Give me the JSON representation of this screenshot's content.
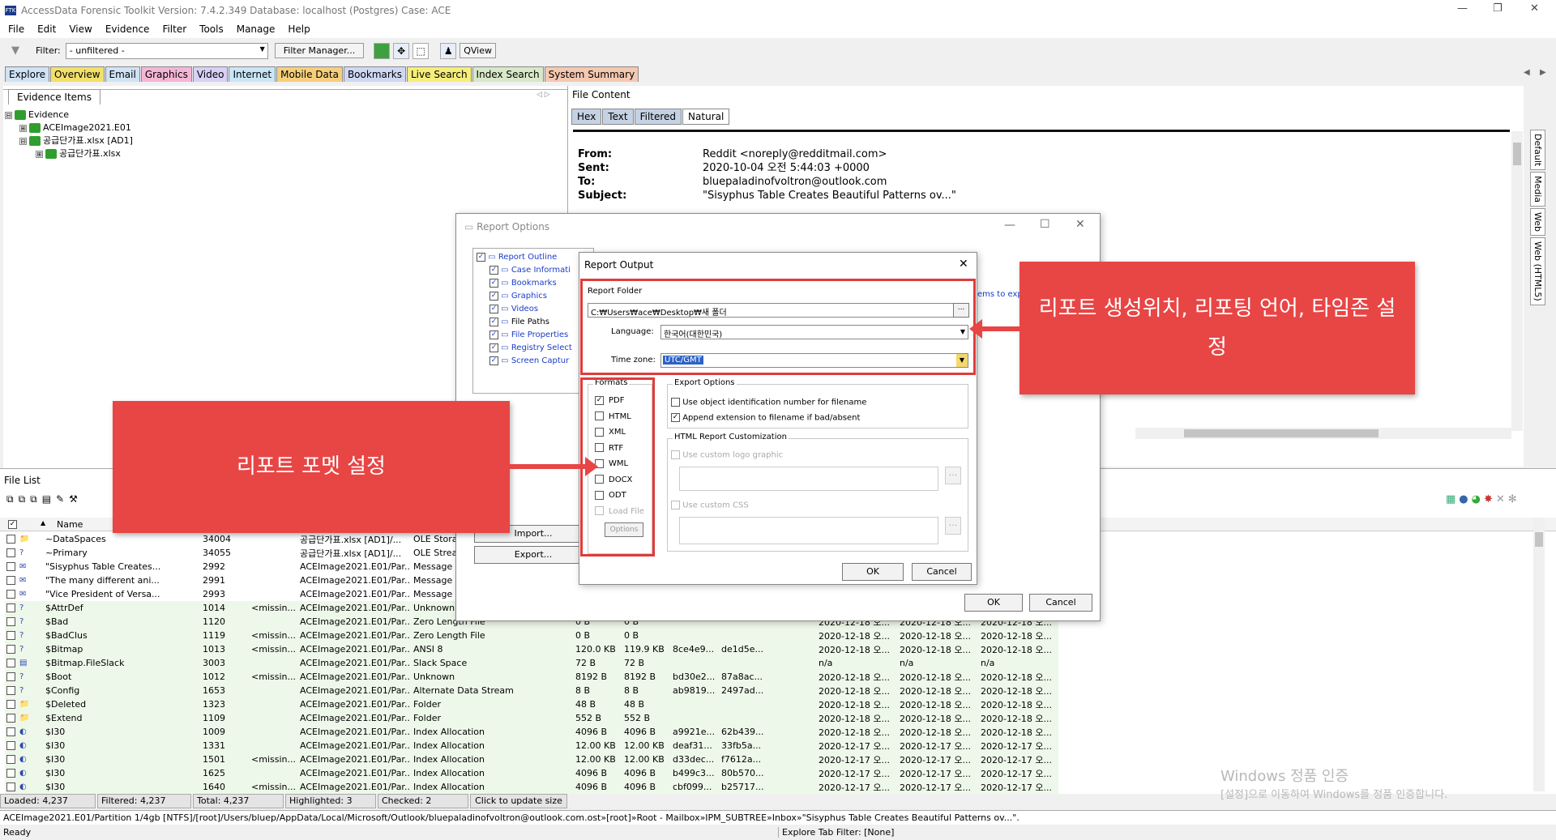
{
  "window": {
    "title": "AccessData Forensic Toolkit Version: 7.4.2.349 Database: localhost (Postgres) Case: ACE",
    "min": "—",
    "max": "❐",
    "close": "✕"
  },
  "menu": [
    "File",
    "Edit",
    "View",
    "Evidence",
    "Filter",
    "Tools",
    "Manage",
    "Help"
  ],
  "toolbar": {
    "filter_label": "Filter:",
    "filter_value": "- unfiltered -",
    "filter_manager": "Filter Manager...",
    "qview": "QView"
  },
  "main_tabs": [
    "Explore",
    "Overview",
    "Email",
    "Graphics",
    "Video",
    "Internet",
    "Mobile Data",
    "Bookmarks",
    "Live Search",
    "Index Search",
    "System Summary"
  ],
  "evidence_pane": {
    "tab": "Evidence Items",
    "tree": [
      {
        "label": "Evidence",
        "toggle": "⊟"
      },
      {
        "label": "ACEImage2021.E01",
        "toggle": "⊞"
      },
      {
        "label": "공급단가표.xlsx [AD1]",
        "toggle": "⊟"
      },
      {
        "label": "공급단가표.xlsx",
        "toggle": "⊞"
      }
    ]
  },
  "file_content": {
    "title": "File Content",
    "tabs": [
      "Hex",
      "Text",
      "Filtered",
      "Natural"
    ],
    "email": {
      "from_label": "From:",
      "from": "Reddit <noreply@redditmail.com>",
      "sent_label": "Sent:",
      "sent": "2020-10-04 오전 5:44:03 +0000",
      "to_label": "To:",
      "to": "bluepaladinofvoltron@outlook.com",
      "subject_label": "Subject:",
      "subject": "\"Sisyphus Table Creates Beautiful Patterns ov...\""
    }
  },
  "side_tabs": [
    "Default",
    "Media",
    "Web",
    "Web (HTML5)"
  ],
  "report_options": {
    "title": "Report Options",
    "outline": [
      "Report Outline",
      "Case Informati",
      "Bookmarks",
      "Graphics",
      "Videos",
      "File Paths",
      "File Properties",
      "Registry Select",
      "Screen Captur"
    ],
    "import": "Import...",
    "export": "Export...",
    "ok": "OK",
    "cancel": "Cancel",
    "items_to_exp": "ems to exp"
  },
  "report_output": {
    "title": "Report Output",
    "folder_label": "Report Folder",
    "folder_value": "C:₩Users₩ace₩Desktop₩새 폴더",
    "browse": "...",
    "language_label": "Language:",
    "language_value": "한국어(대한민국)",
    "tz_label": "Time zone:",
    "tz_value": "UTC/GMT",
    "formats_label": "Formats",
    "formats": [
      {
        "name": "PDF",
        "checked": true
      },
      {
        "name": "HTML",
        "checked": false
      },
      {
        "name": "XML",
        "checked": false
      },
      {
        "name": "RTF",
        "checked": false
      },
      {
        "name": "WML",
        "checked": false
      },
      {
        "name": "DOCX",
        "checked": false
      },
      {
        "name": "ODT",
        "checked": false
      },
      {
        "name": "Load File",
        "checked": false
      }
    ],
    "options_btn": "Options",
    "export_options_label": "Export Options",
    "export_opt1": "Use object identification number for filename",
    "export_opt2": "Append extension to filename if bad/absent",
    "html_custom_label": "HTML Report Customization",
    "logo_label": "Use custom logo graphic",
    "css_label": "Use custom CSS",
    "ok": "OK",
    "cancel": "Cancel"
  },
  "callouts": {
    "top": "리포트 생성위치, 리포팅 언어, 타임존 설정",
    "left": "리포트 포멧 설정"
  },
  "file_list": {
    "title": "File List",
    "name_header": "Name",
    "rows": [
      [
        "~DataSpaces",
        "34004",
        "",
        "공급단가표.xlsx [AD1]/...",
        "OLE Storag",
        "",
        "",
        "",
        "",
        "",
        "",
        ""
      ],
      [
        "~Primary",
        "34055",
        "",
        "공급단가표.xlsx [AD1]/...",
        "OLE Stream",
        "",
        "",
        "",
        "",
        "",
        "",
        ""
      ],
      [
        "\"Sisyphus Table Creates...",
        "2992",
        "",
        "ACEImage2021.E01/Par...",
        "Message",
        "",
        "",
        "",
        "",
        "",
        "",
        ""
      ],
      [
        "\"The many different ani...",
        "2991",
        "",
        "ACEImage2021.E01/Par...",
        "Message",
        "",
        "",
        "",
        "",
        "",
        "",
        ""
      ],
      [
        "\"Vice President of Versa...",
        "2993",
        "",
        "ACEImage2021.E01/Par...",
        "Message",
        "",
        "",
        "",
        "",
        "",
        "",
        ""
      ],
      [
        "$AttrDef",
        "1014",
        "<missin...",
        "ACEImage2021.E01/Par...",
        "Unknown",
        "",
        "",
        "",
        "",
        "",
        "",
        ""
      ],
      [
        "$Bad",
        "1120",
        "",
        "ACEImage2021.E01/Par...",
        "Zero Length File",
        "0 B",
        "0 B",
        "",
        "",
        "2020-12-18 오...",
        "2020-12-18 오...",
        "2020-12-18 오..."
      ],
      [
        "$BadClus",
        "1119",
        "<missin...",
        "ACEImage2021.E01/Par...",
        "Zero Length File",
        "0 B",
        "0 B",
        "",
        "",
        "2020-12-18 오...",
        "2020-12-18 오...",
        "2020-12-18 오..."
      ],
      [
        "$Bitmap",
        "1013",
        "<missin...",
        "ACEImage2021.E01/Par...",
        "ANSI 8",
        "120.0 KB",
        "119.9 KB",
        "8ce4e9...",
        "de1d5e...",
        "2020-12-18 오...",
        "2020-12-18 오...",
        "2020-12-18 오..."
      ],
      [
        "$Bitmap.FileSlack",
        "3003",
        "",
        "ACEImage2021.E01/Par...",
        "Slack Space",
        "72 B",
        "72 B",
        "",
        "",
        "n/a",
        "n/a",
        "n/a"
      ],
      [
        "$Boot",
        "1012",
        "<missin...",
        "ACEImage2021.E01/Par...",
        "Unknown",
        "8192 B",
        "8192 B",
        "bd30e2...",
        "87a8ac...",
        "2020-12-18 오...",
        "2020-12-18 오...",
        "2020-12-18 오..."
      ],
      [
        "$Config",
        "1653",
        "",
        "ACEImage2021.E01/Par...",
        "Alternate Data Stream",
        "8 B",
        "8 B",
        "ab9819...",
        "2497ad...",
        "2020-12-18 오...",
        "2020-12-18 오...",
        "2020-12-18 오..."
      ],
      [
        "$Deleted",
        "1323",
        "",
        "ACEImage2021.E01/Par...",
        "Folder",
        "48 B",
        "48 B",
        "",
        "",
        "2020-12-18 오...",
        "2020-12-18 오...",
        "2020-12-18 오..."
      ],
      [
        "$Extend",
        "1109",
        "",
        "ACEImage2021.E01/Par...",
        "Folder",
        "552 B",
        "552 B",
        "",
        "",
        "2020-12-18 오...",
        "2020-12-18 오...",
        "2020-12-18 오..."
      ],
      [
        "$I30",
        "1009",
        "",
        "ACEImage2021.E01/Par...",
        "Index Allocation",
        "4096 B",
        "4096 B",
        "a9921e...",
        "62b439...",
        "2020-12-18 오...",
        "2020-12-18 오...",
        "2020-12-18 오..."
      ],
      [
        "$I30",
        "1331",
        "",
        "ACEImage2021.E01/Par...",
        "Index Allocation",
        "12.00 KB",
        "12.00 KB",
        "deaf31...",
        "33fb5a...",
        "2020-12-17 오...",
        "2020-12-17 오...",
        "2020-12-17 오..."
      ],
      [
        "$I30",
        "1501",
        "<missin...",
        "ACEImage2021.E01/Par...",
        "Index Allocation",
        "12.00 KB",
        "12.00 KB",
        "d33dec...",
        "f7612a...",
        "2020-12-17 오...",
        "2020-12-17 오...",
        "2020-12-17 오..."
      ],
      [
        "$I30",
        "1625",
        "",
        "ACEImage2021.E01/Par...",
        "Index Allocation",
        "4096 B",
        "4096 B",
        "b499c3...",
        "80b570...",
        "2020-12-17 오...",
        "2020-12-17 오...",
        "2020-12-17 오..."
      ],
      [
        "$I30",
        "1640",
        "<missin...",
        "ACEImage2021.E01/Par...",
        "Index Allocation",
        "4096 B",
        "4096 B",
        "cbf099...",
        "b25717...",
        "2020-12-17 오...",
        "2020-12-17 오...",
        "2020-12-17 오..."
      ]
    ]
  },
  "status": {
    "loaded": "Loaded: 4,237",
    "filtered": "Filtered: 4,237",
    "total": "Total: 4,237",
    "highlighted": "Highlighted: 3",
    "checked": "Checked: 2",
    "update": "Click to update size",
    "path": "ACEImage2021.E01/Partition 1/4gb [NTFS]/[root]/Users/bluep/AppData/Local/Microsoft/Outlook/bluepaladinofvoltron@outlook.com.ost»[root]»Root - Mailbox»IPM_SUBTREE»Inbox»\"Sisyphus Table Creates Beautiful Patterns ov...\".",
    "ready": "Ready",
    "explore_filter": "Explore Tab Filter: [None]"
  },
  "watermark": {
    "line1": "Windows 정품 인증",
    "line2": "[설정]으로 이동하여 Windows를 정품 인증합니다."
  }
}
